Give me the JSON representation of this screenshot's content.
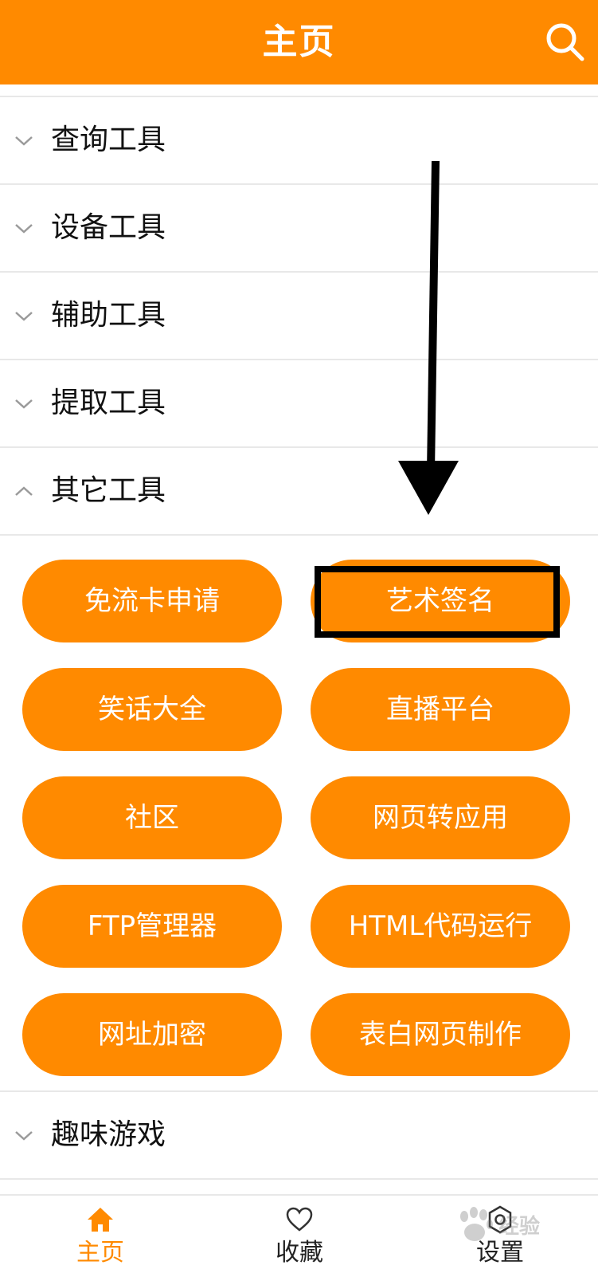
{
  "header": {
    "title": "主页",
    "search_icon": "search-icon",
    "background": "#ff8a00"
  },
  "categories_top": [
    {
      "label": "查询工具",
      "expanded": false
    },
    {
      "label": "设备工具",
      "expanded": false
    },
    {
      "label": "辅助工具",
      "expanded": false
    },
    {
      "label": "提取工具",
      "expanded": false
    },
    {
      "label": "其它工具",
      "expanded": true
    }
  ],
  "tools": [
    "免流卡申请",
    "艺术签名",
    "笑话大全",
    "直播平台",
    "社区",
    "网页转应用",
    "FTP管理器",
    "HTML代码运行",
    "网址加密",
    "表白网页制作"
  ],
  "categories_bottom": [
    {
      "label": "趣味游戏",
      "expanded": false
    }
  ],
  "tabbar": {
    "home": "主页",
    "favorites": "收藏",
    "settings": "设置",
    "active": "home"
  },
  "watermark": {
    "text": "经验",
    "logo": "baidu-paw-icon"
  },
  "colors": {
    "accent": "#ff8a00",
    "divider": "#e8e8e8",
    "annotation": "#000000"
  }
}
